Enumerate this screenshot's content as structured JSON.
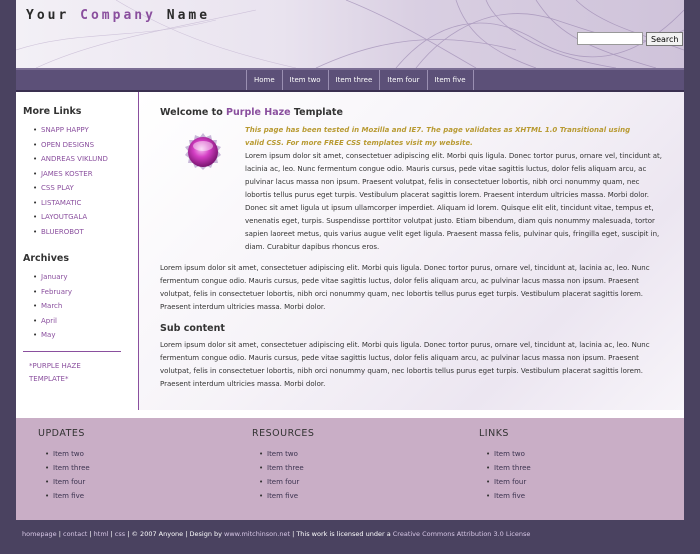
{
  "header": {
    "logo_part1": "Your ",
    "logo_part2": "Company",
    "logo_part3": " Name",
    "search_placeholder": "",
    "search_button": "Search"
  },
  "nav": [
    "Home",
    "Item two",
    "Item three",
    "Item four",
    "Item five"
  ],
  "sidebar": {
    "more_links_title": "More Links",
    "links": [
      "SNAPP HAPPY",
      "OPEN DESIGNS",
      "ANDREAS VIKLUND",
      "JAMES KOSTER",
      "CSS PLAY",
      "LISTAMATIC",
      "LAYOUTGALA",
      "BLUEROBOT"
    ],
    "archives_title": "Archives",
    "archives": [
      "January",
      "February",
      "March",
      "April",
      "May"
    ],
    "promo_line1": "*PURPLE HAZE",
    "promo_line2": "TEMPLATE*"
  },
  "content": {
    "title_part1": "Welcome to ",
    "title_part2": "Purple Haze",
    "title_part3": " Template",
    "note": "This page has been tested in Mozilla and IE7. The page validates as XHTML 1.0 Transitional using valid CSS. For more FREE CSS templates visit my website.",
    "para1": "Lorem ipsum dolor sit amet, consectetuer adipiscing elit. Morbi quis ligula. Donec tortor purus, ornare vel, tincidunt at, lacinia ac, leo. Nunc fermentum congue odio. Mauris cursus, pede vitae sagittis luctus, dolor felis aliquam arcu, ac pulvinar lacus massa non ipsum. Praesent volutpat, felis in consectetuer lobortis, nibh orci nonummy quam, nec lobortis tellus purus eget turpis. Vestibulum placerat sagittis lorem. Praesent interdum ultricies massa. Morbi dolor. Donec sit amet ligula ut ipsum ullamcorper imperdiet. Aliquam id lorem. Quisque elit elit, tincidunt vitae, tempus et, venenatis eget, turpis. Suspendisse porttitor volutpat justo. Etiam bibendum, diam quis nonummy malesuada, tortor sapien laoreet metus, quis varius augue velit eget ligula. Praesent massa felis, pulvinar quis, fringilla eget, suscipit in, diam. Curabitur dapibus rhoncus eros.",
    "para2": "Lorem ipsum dolor sit amet, consectetuer adipiscing elit. Morbi quis ligula. Donec tortor purus, ornare vel, tincidunt at, lacinia ac, leo. Nunc fermentum congue odio. Mauris cursus, pede vitae sagittis luctus, dolor felis aliquam arcu, ac pulvinar lacus massa non ipsum. Praesent volutpat, felis in consectetuer lobortis, nibh orci nonummy quam, nec lobortis tellus purus eget turpis. Vestibulum placerat sagittis lorem. Praesent interdum ultricies massa. Morbi dolor.",
    "sub_title": "Sub content",
    "para3": "Lorem ipsum dolor sit amet, consectetuer adipiscing elit. Morbi quis ligula. Donec tortor purus, ornare vel, tincidunt at, lacinia ac, leo. Nunc fermentum congue odio. Mauris cursus, pede vitae sagittis luctus, dolor felis aliquam arcu, ac pulvinar lacus massa non ipsum. Praesent volutpat, felis in consectetuer lobortis, nibh orci nonummy quam, nec lobortis tellus purus eget turpis. Vestibulum placerat sagittis lorem. Praesent interdum ultricies massa. Morbi dolor."
  },
  "footer_cols": [
    {
      "title": "UPDATES",
      "items": [
        "Item two",
        "Item three",
        "Item four",
        "Item five"
      ]
    },
    {
      "title": "RESOURCES",
      "items": [
        "Item two",
        "Item three",
        "Item four",
        "Item five"
      ]
    },
    {
      "title": "LINKS",
      "items": [
        "Item two",
        "Item three",
        "Item four",
        "Item five"
      ]
    }
  ],
  "bottombar": {
    "homepage": "homepage",
    "contact": "contact",
    "html": "html",
    "css": "css",
    "copyright": " © 2007 Anyone | Design by ",
    "designer": "www.mitchinson.net",
    "license_text": " | This work is licensed under a ",
    "license_link": "Creative Commons Attribution 3.0 License"
  },
  "colors": {
    "accent": "#8a4f9e",
    "nav_bg": "#5c5078",
    "footer_bg": "#c9aec6",
    "page_bg": "#4a4260",
    "note": "#b89a32"
  }
}
